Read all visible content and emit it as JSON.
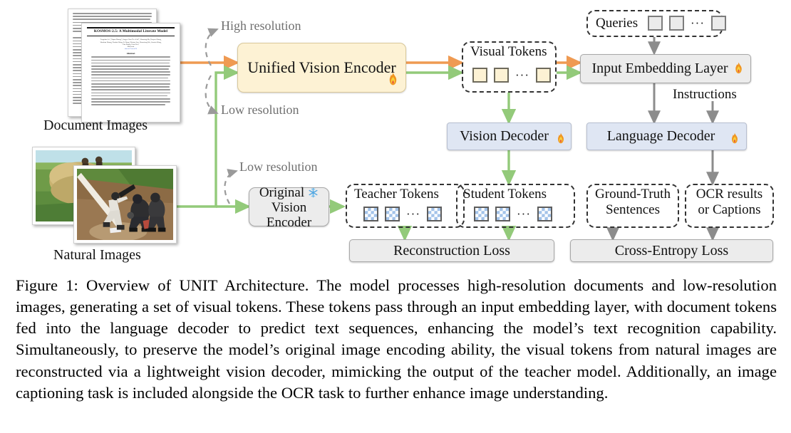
{
  "figure": {
    "caption": "Figure 1: Overview of UNIT Architecture. The model processes high-resolution documents and low-resolution images, generating a set of visual tokens. These tokens pass through an input embedding layer, with document tokens fed into the language decoder to predict text sequences, enhancing the model’s text recognition capability. Simultaneously, to preserve the model’s original image encoding ability, the visual tokens from natural images are reconstructed via a lightweight vision decoder, mimicking the output of the teacher model. Additionally, an image captioning task is included alongside the OCR task to further enhance image understanding."
  },
  "inputs": {
    "document_images_label": "Document Images",
    "natural_images_label": "Natural Images",
    "document_paper": {
      "title": "KOSMOS-2.5: A Multimodal Literate Model",
      "authors_line_1": "Tengchao Lv*, Yupan Huang*, Jingye Chen¹ Lei Cui¹*, Shuming Ma, Yaoyao Chang,",
      "authors_line_2": "Shaohan Huang, Wenhui Wang, Li Dong, Weiyao Luo, Shaoxiang Wu, Guoxin Wang,",
      "authors_line_3": "Cha Zhang, Furu Wei†",
      "affiliation": "Microsoft",
      "link": "aka.ms/GeneralAI",
      "abstract_heading": "Abstract"
    }
  },
  "resolution_labels": {
    "high": "High resolution",
    "low_top": "Low resolution",
    "low_bottom": "Low resolution"
  },
  "nodes": {
    "unified_vision_encoder": {
      "label": "Unified Vision Encoder",
      "state_icon": "fire-icon",
      "color": "#fdf2d4"
    },
    "original_vision_encoder": {
      "label_line_1": "Original",
      "label_line_2": "Vision Encoder",
      "state_icon": "snowflake-icon",
      "color": "#ececec"
    },
    "vision_decoder": {
      "label": "Vision Decoder",
      "state_icon": "fire-icon",
      "color": "#dfe6f3"
    },
    "language_decoder": {
      "label": "Language Decoder",
      "state_icon": "fire-icon",
      "color": "#dfe6f3"
    },
    "input_embedding_layer": {
      "label": "Input Embedding Layer",
      "state_icon": "fire-icon",
      "color": "#ececec"
    },
    "reconstruction_loss": {
      "label": "Reconstruction Loss",
      "color": "#ececec"
    },
    "cross_entropy_loss": {
      "label": "Cross-Entropy Loss",
      "color": "#ececec"
    }
  },
  "token_groups": {
    "visual_tokens": {
      "label": "Visual Tokens",
      "ellipsis": "···",
      "token_count": 3,
      "token_style": "yellow-square"
    },
    "queries": {
      "label": "Queries",
      "ellipsis": "···",
      "token_count": 3,
      "token_style": "gray-square"
    },
    "teacher_tokens": {
      "label": "Teacher Tokens",
      "ellipsis": "···",
      "token_count": 3,
      "token_style": "blue-checker"
    },
    "student_tokens": {
      "label": "Student Tokens",
      "ellipsis": "···",
      "token_count": 3,
      "token_style": "blue-checker"
    }
  },
  "text_sources": {
    "ground_truth": {
      "line_1": "Ground-Truth",
      "line_2": "Sentences"
    },
    "ocr_results": {
      "line_1": "OCR results",
      "line_2": "or Captions"
    }
  },
  "edge_labels": {
    "instructions": "Instructions"
  },
  "colors": {
    "orange_arrow": "#ef9a52",
    "green_arrow": "#93ca7a",
    "gray_arrow": "#8c8c8c",
    "dashed_gray": "#9a9a9a",
    "yellow_fill": "#fdf2d4",
    "blue_fill": "#dfe6f3",
    "gray_fill": "#ececec"
  }
}
